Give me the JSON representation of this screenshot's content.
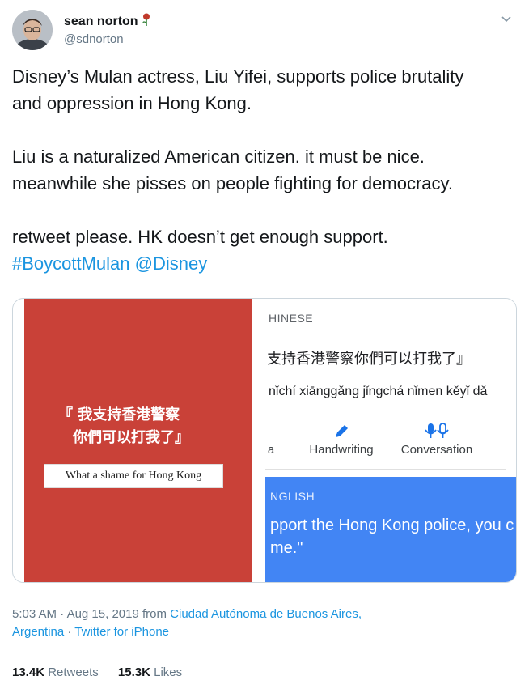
{
  "user": {
    "display_name": "sean norton",
    "handle": "@sdnorton",
    "name_emoji_icon": "rose-icon"
  },
  "tweet": {
    "text_line1": "Disney’s Mulan actress, Liu Yifei, supports police brutality",
    "text_line2": "and oppression in Hong Kong.",
    "text_line3": "Liu is a naturalized American citizen. it must be nice.",
    "text_line4": "meanwhile she pisses on people fighting for democracy.",
    "text_line5": "retweet please. HK doesn’t get enough support.",
    "hashtag": "#BoycottMulan",
    "mention": "@Disney"
  },
  "media": {
    "left": {
      "quote_line1": "『 我支持香港警察",
      "quote_line2": "你們可以打我了』",
      "caption": "What a shame for Hong Kong"
    },
    "right": {
      "source_label": "HINESE",
      "source_text": "支持香港警察你們可以打我了』",
      "pinyin": "nǐchí xiānggǎng jǐngchá nǐmen kěyǐ dǎ",
      "mode_cut": "a",
      "mode_handwriting": "Handwriting",
      "mode_conversation": "Conversation",
      "target_label": "NGLISH",
      "target_text": "pport the Hong Kong police, you c\nme.\""
    }
  },
  "meta": {
    "time": "5:03 AM",
    "date": "Aug 15, 2019",
    "from": "from",
    "location_line1": "Ciudad Autónoma de Buenos Aires,",
    "location_line2": "Argentina",
    "client": "Twitter for iPhone"
  },
  "stats": {
    "retweets_count": "13.4K",
    "retweets_label": "Retweets",
    "likes_count": "15.3K",
    "likes_label": "Likes"
  },
  "colors": {
    "link": "#1b95e0",
    "media_red": "#c94138",
    "translate_blue": "#4285f4"
  }
}
